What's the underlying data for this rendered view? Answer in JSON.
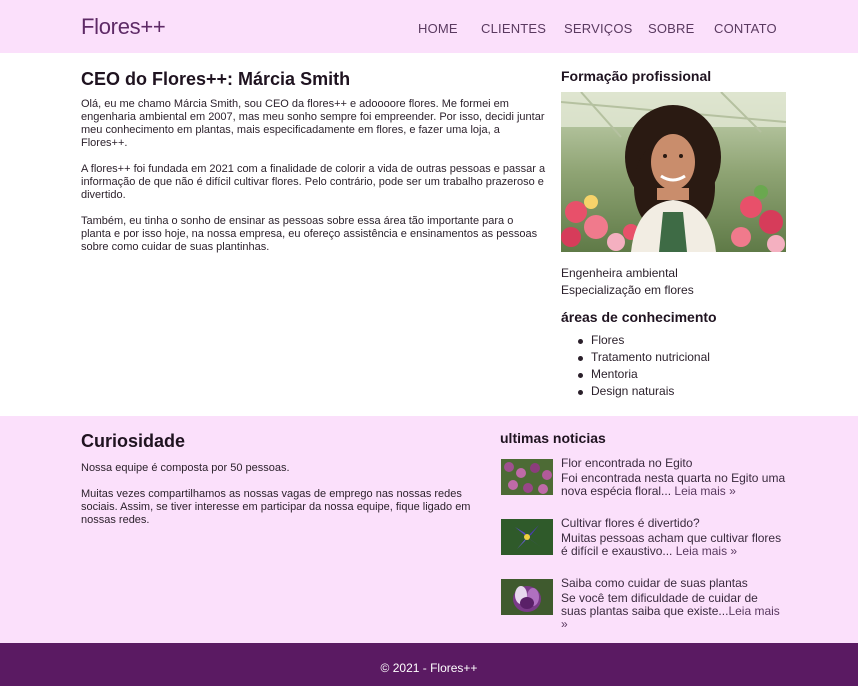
{
  "header": {
    "brand": "Flores++",
    "nav": [
      "HOME",
      "CLIENTES",
      "SERVIÇOS",
      "SOBRE",
      "CONTATO"
    ]
  },
  "ceo": {
    "title": "CEO do Flores++: Márcia Smith",
    "paragraphs": [
      "Olá, eu me chamo Márcia Smith, sou CEO da flores++ e adoooore flores. Me formei em engenharia ambiental em 2007, mas meu sonho sempre foi empreender. Por isso, decidi juntar meu conhecimento em plantas, mais especificadamente em flores, e fazer uma loja, a Flores++.",
      "A flores++ foi fundada em 2021 com a finalidade de colorir a vida de outras pessoas e passar a informação de que não é difícil cultivar flores. Pelo contrário, pode ser um trabalho prazeroso e divertido.",
      "Também, eu tinha o sonho de ensinar as pessoas sobre essa área tão importante para o planta e por isso hoje, na nossa empresa, eu ofereço assistência e ensinamentos as pessoas sobre como cuidar de suas plantinhas."
    ]
  },
  "sidebar": {
    "title": "Formação profissional",
    "education": [
      "Engenheira ambiental",
      "Especialização em flores"
    ],
    "areas_title": "áreas de conhecimento",
    "areas": [
      "Flores",
      "Tratamento nutricional",
      "Mentoria",
      "Design naturais"
    ]
  },
  "curiosity": {
    "title": "Curiosidade",
    "paragraphs": [
      "Nossa equipe é composta por 50 pessoas.",
      "Muitas vezes compartilhamos as nossas vagas de emprego nas nossas redes sociais. Assim, se tiver interesse em participar da nossa equipe, fique ligado em nossas redes."
    ]
  },
  "news": {
    "title": "ultimas noticias",
    "items": [
      {
        "headline": "Flor encontrada no Egito",
        "text": "Foi encontrada nesta quarta no Egito uma nova espécia floral...",
        "more": "Leia mais »"
      },
      {
        "headline": "Cultivar flores é divertido?",
        "text": "Muitas pessoas acham que cultivar flores é difícil e exaustivo...",
        "more": "Leia mais »"
      },
      {
        "headline": "Saiba como cuidar de suas plantas",
        "text": "Se você tem dificuldade de cuidar de suas plantas saiba que existe...",
        "more": "Leia mais »"
      }
    ]
  },
  "footer": {
    "copyright": "© 2021 - Flores++"
  },
  "colors": {
    "header_bg": "#fbe0fb",
    "band_bg": "#fbe0fb",
    "footer_bg": "#5a1a62",
    "brand": "#5e2a66"
  }
}
